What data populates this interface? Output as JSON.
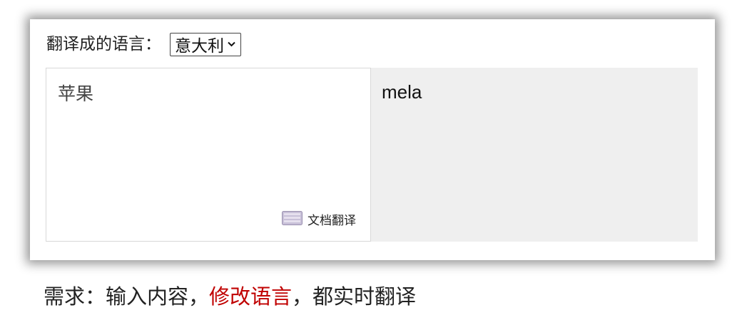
{
  "language_selector": {
    "label": "翻译成的语言：",
    "selected": "意大利"
  },
  "source": {
    "text": "苹果",
    "document_translate_label": "文档翻译"
  },
  "target": {
    "text": "mela"
  },
  "caption": {
    "part1": "需求：输入内容，",
    "highlight": "修改语言",
    "part2": "，都实时翻译"
  },
  "colors": {
    "highlight": "#c00000",
    "result_bg": "#efefef"
  }
}
